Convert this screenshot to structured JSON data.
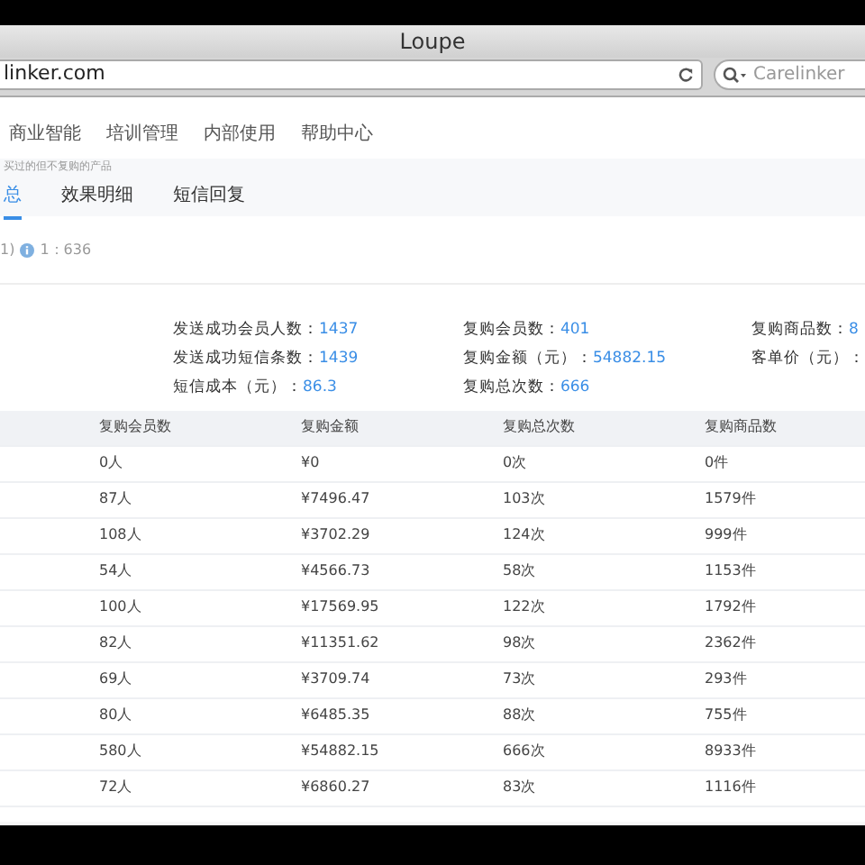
{
  "window": {
    "title": "Loupe"
  },
  "address_bar": {
    "url": "linker.com"
  },
  "search": {
    "placeholder": "Carelinker"
  },
  "nav": {
    "items": [
      "商业智能",
      "培训管理",
      "内部使用",
      "帮助中心"
    ]
  },
  "breadcrumb": "买过的但不复购的产品",
  "tabs": [
    {
      "label": "总",
      "selected": true
    },
    {
      "label": "效果明细",
      "selected": false
    },
    {
      "label": "短信回复",
      "selected": false
    }
  ],
  "filter": {
    "prefix": "1)",
    "info": "1：636"
  },
  "stats": [
    [
      {
        "label": "发送成功会员人数：",
        "value": "1437"
      },
      {
        "label": "发送成功短信条数：",
        "value": "1439"
      },
      {
        "label": "短信成本（元）：",
        "value": "86.3"
      }
    ],
    [
      {
        "label": "复购会员数：",
        "value": "401"
      },
      {
        "label": "复购金额（元）：",
        "value": "54882.15"
      },
      {
        "label": "复购总次数：",
        "value": "666"
      }
    ],
    [
      {
        "label": "复购商品数：",
        "value": "8"
      },
      {
        "label": "客单价（元）："
      }
    ]
  ],
  "table": {
    "columns": [
      "复购会员数",
      "复购金额",
      "复购总次数",
      "复购商品数"
    ],
    "rows": [
      [
        "0人",
        "¥0",
        "0次",
        "0件"
      ],
      [
        "87人",
        "¥7496.47",
        "103次",
        "1579件"
      ],
      [
        "108人",
        "¥3702.29",
        "124次",
        "999件"
      ],
      [
        "54人",
        "¥4566.73",
        "58次",
        "1153件"
      ],
      [
        "100人",
        "¥17569.95",
        "122次",
        "1792件"
      ],
      [
        "82人",
        "¥11351.62",
        "98次",
        "2362件"
      ],
      [
        "69人",
        "¥3709.74",
        "73次",
        "293件"
      ],
      [
        "80人",
        "¥6485.35",
        "88次",
        "755件"
      ],
      [
        "580人",
        "¥54882.15",
        "666次",
        "8933件"
      ],
      [
        "72人",
        "¥6860.27",
        "83次",
        "1116件"
      ]
    ]
  }
}
